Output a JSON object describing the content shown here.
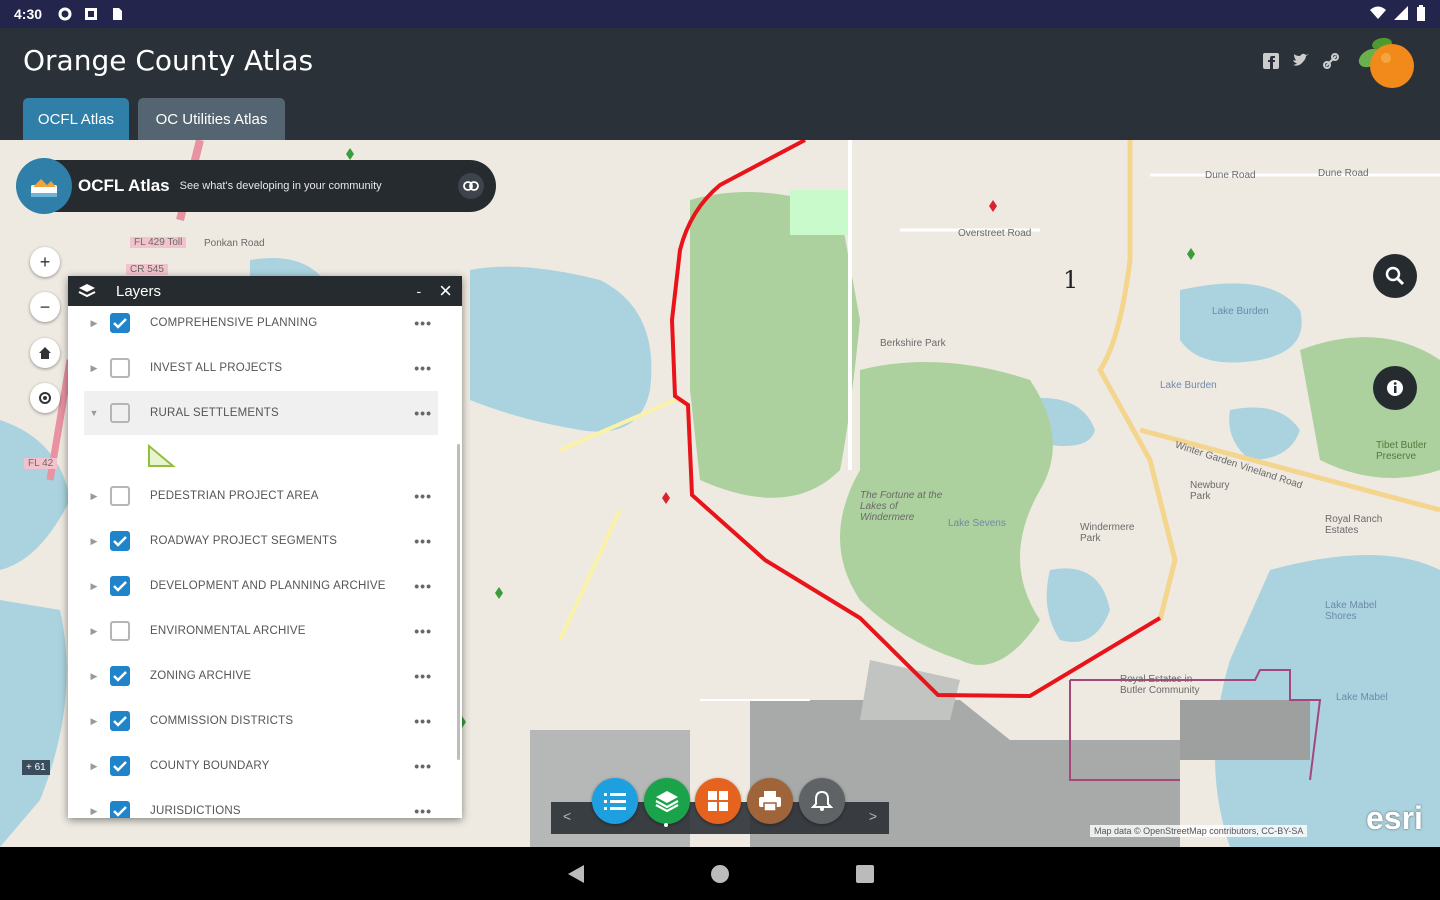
{
  "status_bar": {
    "time": "4:30",
    "icons_left": [
      "gear-icon",
      "portrait-icon",
      "sdcard-icon"
    ],
    "icons_right": [
      "wifi-icon",
      "signal-icon",
      "battery-icon"
    ]
  },
  "header": {
    "title": "Orange County Atlas",
    "share_icons": [
      "facebook-icon",
      "twitter-icon",
      "link-icon"
    ],
    "tabs": [
      {
        "label": "OCFL Atlas",
        "active": true
      },
      {
        "label": "OC Utilities Atlas",
        "active": false
      }
    ]
  },
  "map_banner": {
    "title": "OCFL Atlas",
    "subtitle": "See what's developing in your community"
  },
  "map": {
    "district_number": "1",
    "labels": {
      "fl429": "FL 429 Toll",
      "ponkan": "Ponkan Road",
      "cr545": "CR 545",
      "fl42": "FL 42",
      "dune1": "Dune Road",
      "dune2": "Dune Road",
      "overstreet": "Overstreet Road",
      "berkshire": "Berkshire Park",
      "lakeburden": "Lake Burden",
      "lakeburden2": "Lake Burden",
      "lakesevern": "Lake Sevens",
      "fortune": "The Fortune at the Lakes of Windermere",
      "lakemabel_shores": "Lake Mabel Shores",
      "lakemabel": "Lake Mabel",
      "royal_estates": "Royal Estates in Butler Community",
      "windermere_park": "Windermere Park",
      "royal_ranch": "Royal Ranch Estates",
      "newbury": "Newbury Park",
      "butler_preserve": "Tibet Butler Preserve",
      "winter_garden_vineland": "Winter Garden Vineland Road"
    },
    "scale": "+ 61",
    "attribution": "Map data © OpenStreetMap contributors, CC-BY-SA",
    "esri": "esri"
  },
  "layers_panel": {
    "title": "Layers",
    "minimize": "-",
    "close": "×",
    "items": [
      {
        "label": "COMPREHENSIVE PLANNING",
        "checked": true,
        "expanded": false
      },
      {
        "label": "INVEST ALL PROJECTS",
        "checked": false,
        "expanded": false
      },
      {
        "label": "RURAL SETTLEMENTS",
        "checked": false,
        "expanded": true
      },
      {
        "label": "PEDESTRIAN PROJECT AREA",
        "checked": false,
        "expanded": false
      },
      {
        "label": "ROADWAY PROJECT SEGMENTS",
        "checked": true,
        "expanded": false
      },
      {
        "label": "DEVELOPMENT AND PLANNING ARCHIVE",
        "checked": true,
        "expanded": false
      },
      {
        "label": "ENVIRONMENTAL ARCHIVE",
        "checked": false,
        "expanded": false
      },
      {
        "label": "ZONING ARCHIVE",
        "checked": true,
        "expanded": false
      },
      {
        "label": "COMMISSION DISTRICTS",
        "checked": true,
        "expanded": false
      },
      {
        "label": "COUNTY BOUNDARY",
        "checked": true,
        "expanded": false
      },
      {
        "label": "JURISDICTIONS",
        "checked": true,
        "expanded": false
      }
    ],
    "more_label": "•••"
  },
  "dock": {
    "prev": "<",
    "next": ">",
    "buttons": [
      "list-icon",
      "layers-icon",
      "basemap-grid-icon",
      "print-icon",
      "alert-bell-icon"
    ]
  },
  "colors": {
    "header": "#2a3138",
    "statusbar": "#24254c",
    "accent": "#2f7fa8",
    "check": "#1f84c9",
    "district_line": "#e8141a"
  }
}
